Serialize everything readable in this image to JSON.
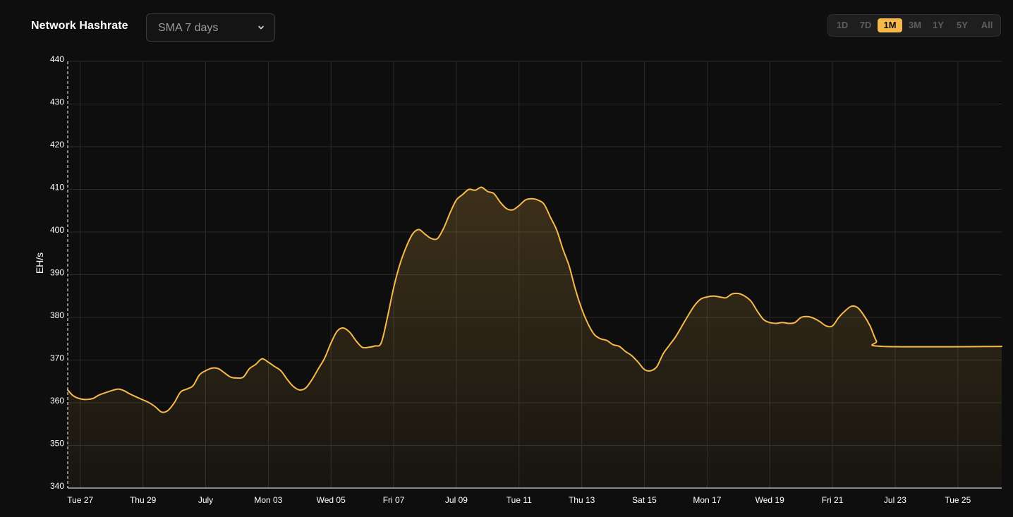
{
  "header": {
    "title": "Network Hashrate",
    "select_value": "SMA 7 days",
    "ranges": [
      "1D",
      "7D",
      "1M",
      "3M",
      "1Y",
      "5Y",
      "All"
    ],
    "active_range": "1M"
  },
  "colors": {
    "background": "#0e0e0e",
    "line": "#f7b94a",
    "grid": "#2a2a2a",
    "accent": "#f7b94a"
  },
  "chart_data": {
    "type": "area",
    "title": "Network Hashrate",
    "xlabel": "",
    "ylabel": "EH/s",
    "ylim": [
      340,
      440
    ],
    "yticks": [
      340,
      350,
      360,
      370,
      380,
      390,
      400,
      410,
      420,
      430,
      440
    ],
    "grid": true,
    "xticks": [
      {
        "t": 0.4,
        "label": "Tue 27"
      },
      {
        "t": 2.4,
        "label": "Thu 29"
      },
      {
        "t": 4.4,
        "label": "July"
      },
      {
        "t": 6.4,
        "label": "Mon 03"
      },
      {
        "t": 8.4,
        "label": "Wed 05"
      },
      {
        "t": 10.4,
        "label": "Fri 07"
      },
      {
        "t": 12.4,
        "label": "Jul 09"
      },
      {
        "t": 14.4,
        "label": "Tue 11"
      },
      {
        "t": 16.4,
        "label": "Thu 13"
      },
      {
        "t": 18.4,
        "label": "Sat 15"
      },
      {
        "t": 20.4,
        "label": "Mon 17"
      },
      {
        "t": 22.4,
        "label": "Wed 19"
      },
      {
        "t": 24.4,
        "label": "Fri 21"
      },
      {
        "t": 26.4,
        "label": "Jul 23"
      },
      {
        "t": 28.4,
        "label": "Tue 25"
      }
    ],
    "xlim": [
      0,
      29.8
    ],
    "series": [
      {
        "values": [
          [
            0.0,
            363.0
          ],
          [
            0.2,
            361.5
          ],
          [
            0.5,
            360.8
          ],
          [
            0.8,
            361.0
          ],
          [
            1.0,
            361.8
          ],
          [
            1.3,
            362.6
          ],
          [
            1.6,
            363.2
          ],
          [
            1.8,
            362.8
          ],
          [
            2.0,
            362.0
          ],
          [
            2.3,
            361.0
          ],
          [
            2.6,
            360.0
          ],
          [
            2.8,
            359.0
          ],
          [
            3.0,
            357.8
          ],
          [
            3.2,
            358.2
          ],
          [
            3.4,
            360.0
          ],
          [
            3.6,
            362.5
          ],
          [
            3.8,
            363.2
          ],
          [
            4.0,
            364.0
          ],
          [
            4.2,
            366.5
          ],
          [
            4.4,
            367.5
          ],
          [
            4.6,
            368.1
          ],
          [
            4.8,
            368.0
          ],
          [
            5.0,
            367.0
          ],
          [
            5.2,
            366.0
          ],
          [
            5.4,
            365.8
          ],
          [
            5.6,
            366.0
          ],
          [
            5.8,
            368.0
          ],
          [
            6.0,
            369.0
          ],
          [
            6.2,
            370.3
          ],
          [
            6.4,
            369.5
          ],
          [
            6.6,
            368.5
          ],
          [
            6.8,
            367.5
          ],
          [
            7.0,
            365.5
          ],
          [
            7.2,
            363.8
          ],
          [
            7.4,
            363.0
          ],
          [
            7.6,
            363.5
          ],
          [
            7.8,
            365.5
          ],
          [
            8.0,
            368.0
          ],
          [
            8.2,
            370.5
          ],
          [
            8.4,
            374.0
          ],
          [
            8.6,
            376.8
          ],
          [
            8.8,
            377.5
          ],
          [
            9.0,
            376.5
          ],
          [
            9.2,
            374.5
          ],
          [
            9.4,
            373.0
          ],
          [
            9.6,
            373.0
          ],
          [
            9.8,
            373.3
          ],
          [
            10.0,
            374.0
          ],
          [
            10.2,
            380.0
          ],
          [
            10.4,
            387.0
          ],
          [
            10.6,
            392.5
          ],
          [
            10.8,
            396.5
          ],
          [
            11.0,
            399.5
          ],
          [
            11.2,
            400.6
          ],
          [
            11.4,
            399.5
          ],
          [
            11.6,
            398.5
          ],
          [
            11.8,
            398.5
          ],
          [
            12.0,
            401.0
          ],
          [
            12.2,
            404.5
          ],
          [
            12.4,
            407.5
          ],
          [
            12.6,
            408.8
          ],
          [
            12.8,
            410.0
          ],
          [
            13.0,
            409.8
          ],
          [
            13.2,
            410.5
          ],
          [
            13.4,
            409.5
          ],
          [
            13.6,
            409.0
          ],
          [
            13.8,
            407.0
          ],
          [
            14.0,
            405.5
          ],
          [
            14.2,
            405.2
          ],
          [
            14.4,
            406.2
          ],
          [
            14.6,
            407.5
          ],
          [
            14.8,
            407.8
          ],
          [
            15.0,
            407.5
          ],
          [
            15.2,
            406.5
          ],
          [
            15.4,
            403.5
          ],
          [
            15.6,
            400.5
          ],
          [
            15.8,
            396.0
          ],
          [
            16.0,
            392.0
          ],
          [
            16.2,
            386.5
          ],
          [
            16.4,
            382.0
          ],
          [
            16.6,
            378.5
          ],
          [
            16.8,
            376.0
          ],
          [
            17.0,
            375.0
          ],
          [
            17.2,
            374.6
          ],
          [
            17.4,
            373.6
          ],
          [
            17.6,
            373.2
          ],
          [
            17.8,
            372.0
          ],
          [
            18.0,
            371.0
          ],
          [
            18.2,
            369.5
          ],
          [
            18.4,
            367.8
          ],
          [
            18.6,
            367.5
          ],
          [
            18.8,
            368.5
          ],
          [
            19.0,
            371.5
          ],
          [
            19.2,
            373.5
          ],
          [
            19.4,
            375.5
          ],
          [
            19.6,
            378.0
          ],
          [
            19.8,
            380.5
          ],
          [
            20.0,
            382.8
          ],
          [
            20.2,
            384.3
          ],
          [
            20.4,
            384.8
          ],
          [
            20.6,
            385.0
          ],
          [
            20.8,
            384.8
          ],
          [
            21.0,
            384.6
          ],
          [
            21.2,
            385.5
          ],
          [
            21.4,
            385.6
          ],
          [
            21.6,
            385.0
          ],
          [
            21.8,
            383.8
          ],
          [
            22.0,
            381.5
          ],
          [
            22.2,
            379.5
          ],
          [
            22.4,
            378.8
          ],
          [
            22.6,
            378.6
          ],
          [
            22.8,
            378.8
          ],
          [
            23.0,
            378.6
          ],
          [
            23.2,
            378.8
          ],
          [
            23.4,
            380.0
          ],
          [
            23.6,
            380.2
          ],
          [
            23.8,
            379.8
          ],
          [
            24.0,
            379.0
          ],
          [
            24.2,
            378.0
          ],
          [
            24.4,
            378.0
          ],
          [
            24.6,
            380.0
          ],
          [
            24.8,
            381.5
          ],
          [
            25.0,
            382.6
          ],
          [
            25.2,
            382.3
          ],
          [
            25.4,
            380.5
          ],
          [
            25.6,
            378.0
          ],
          [
            25.8,
            374.5
          ],
          [
            26.0,
            373.2
          ],
          [
            29.8,
            373.2
          ]
        ]
      }
    ]
  }
}
